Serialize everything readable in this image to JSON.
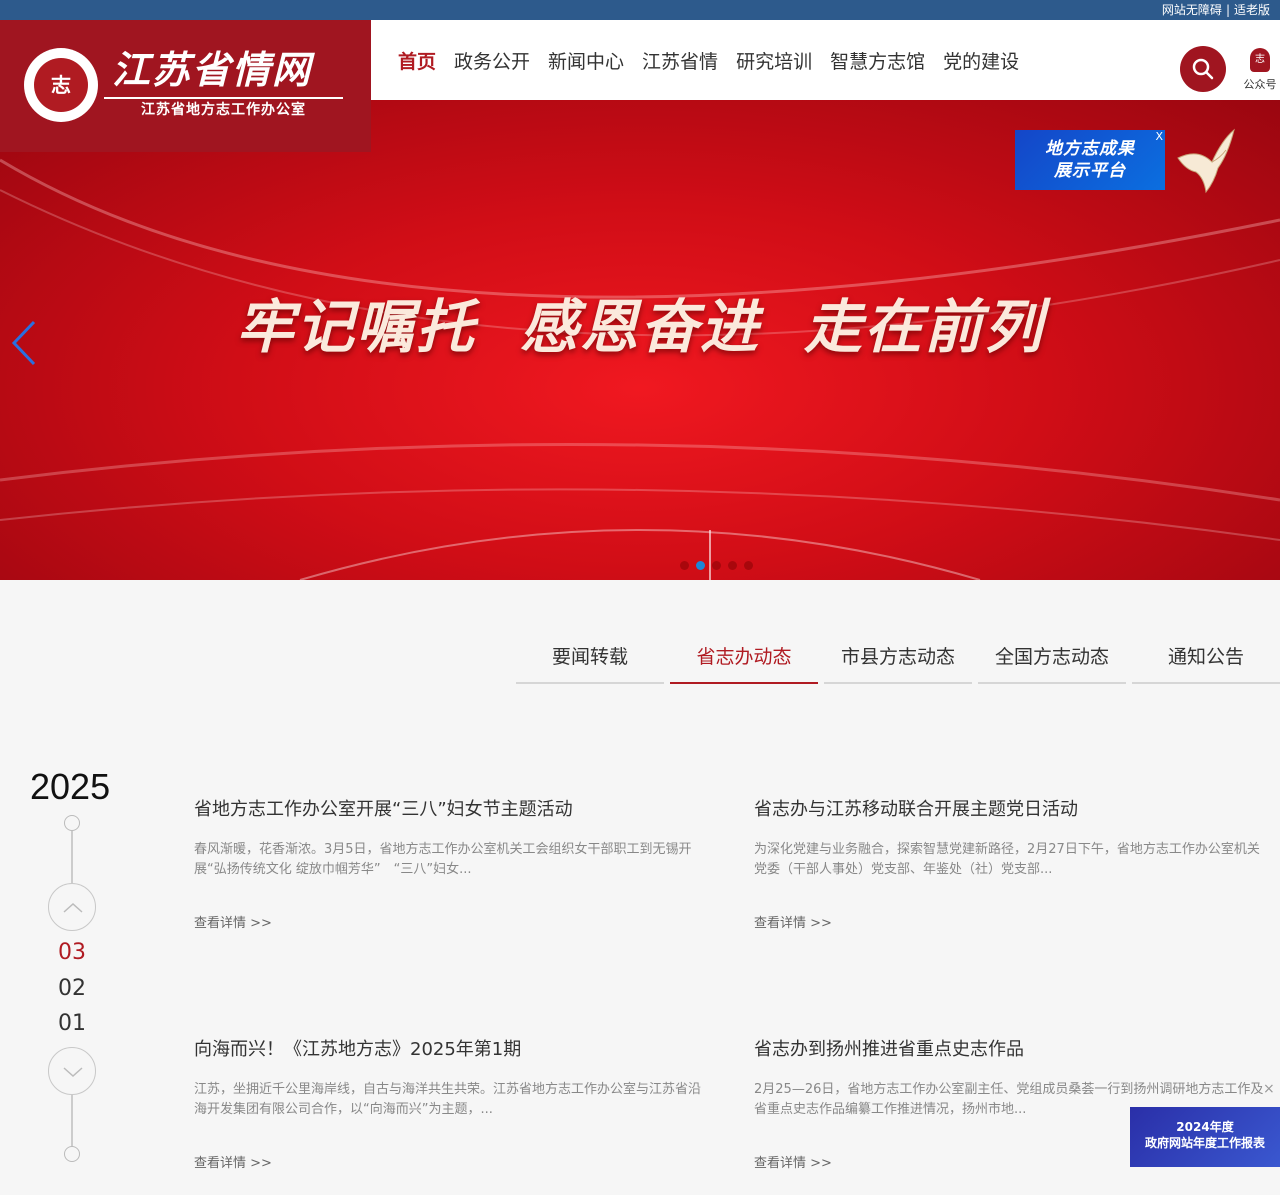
{
  "topbar": {
    "accessible": "网站无障碍",
    "separator": "|",
    "elderly": "适老版"
  },
  "logo": {
    "seal_text": "志",
    "title": "江苏省情网",
    "subtitle": "江苏省地方志工作办公室"
  },
  "nav": {
    "items": [
      "首页",
      "政务公开",
      "新闻中心",
      "江苏省情",
      "研究培训",
      "智慧方志馆",
      "党的建设"
    ],
    "active_index": 0
  },
  "header_right": {
    "search_icon": "search-icon",
    "wechat_label": "公众号"
  },
  "banner": {
    "slogan": [
      "牢记嘱托",
      "感恩奋进",
      "走在前列"
    ],
    "slide_count": 5,
    "active_slide": 1,
    "float_ad": {
      "line1": "地方志成果",
      "line2": "展示平台",
      "close": "X"
    }
  },
  "tabs": {
    "items": [
      "要闻转载",
      "省志办动态",
      "市县方志动态",
      "全国方志动态",
      "通知公告"
    ],
    "active_index": 1
  },
  "timeline": {
    "year": "2025",
    "months": [
      "03",
      "02",
      "01"
    ],
    "active_month": "03"
  },
  "news": [
    {
      "title": "省地方志工作办公室开展“三八”妇女节主题活动",
      "summary": "春风渐暖，花香渐浓。3月5日，省地方志工作办公室机关工会组织女干部职工到无锡开展“弘扬传统文化 绽放巾帼芳华”　“三八”妇女...",
      "more": "查看详情 >>"
    },
    {
      "title": "省志办与江苏移动联合开展主题党日活动",
      "summary": "为深化党建与业务融合，探索智慧党建新路径，2月27日下午，省地方志工作办公室机关党委（干部人事处）党支部、年鉴处（社）党支部...",
      "more": "查看详情 >>"
    },
    {
      "title": "向海而兴！《江苏地方志》2025年第1期",
      "summary": "江苏，坐拥近千公里海岸线，自古与海洋共生共荣。江苏省地方志工作办公室与江苏省沿海开发集团有限公司合作，以“向海而兴”为主题，...",
      "more": "查看详情 >>"
    },
    {
      "title": "省志办到扬州推进省重点史志作品",
      "summary": "2月25—26日，省地方志工作办公室副主任、党组成员桑荟一行到扬州调研地方志工作及省重点史志作品编纂工作推进情况，扬州市地...",
      "more": "查看详情 >>"
    }
  ],
  "report_ad": {
    "line1": "2024年度",
    "line2": "政府网站年度工作报表",
    "close": "×"
  },
  "colors": {
    "brand_red": "#a01520",
    "accent_red": "#b01b22",
    "top_blue": "#2d5a8c",
    "dot_active": "#1e86d8"
  }
}
